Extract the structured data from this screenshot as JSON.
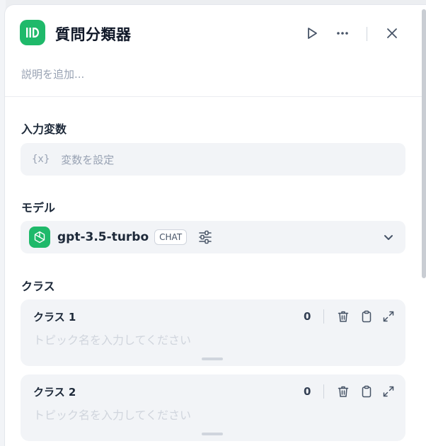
{
  "node": {
    "title": "質問分類器",
    "description_placeholder": "説明を追加..."
  },
  "input_vars": {
    "label": "入力変数",
    "icon_text": "{x}",
    "placeholder": "変数を設定"
  },
  "model": {
    "label": "モデル",
    "name": "gpt-3.5-turbo",
    "badge": "CHAT"
  },
  "classes": {
    "label": "クラス",
    "items": [
      {
        "title": "クラス 1",
        "count": "0",
        "placeholder": "トピック名を入力してください"
      },
      {
        "title": "クラス 2",
        "count": "0",
        "placeholder": "トピック名を入力してください"
      }
    ]
  },
  "colors": {
    "accent": "#1fb96a",
    "panel_bg": "#ffffff",
    "field_bg": "#f2f4f7"
  },
  "icons": [
    "question-classifier-icon",
    "play-icon",
    "more-icon",
    "close-icon",
    "variable-icon",
    "openai-icon",
    "sliders-icon",
    "chevron-down-icon",
    "trash-icon",
    "clipboard-icon",
    "expand-icon"
  ]
}
